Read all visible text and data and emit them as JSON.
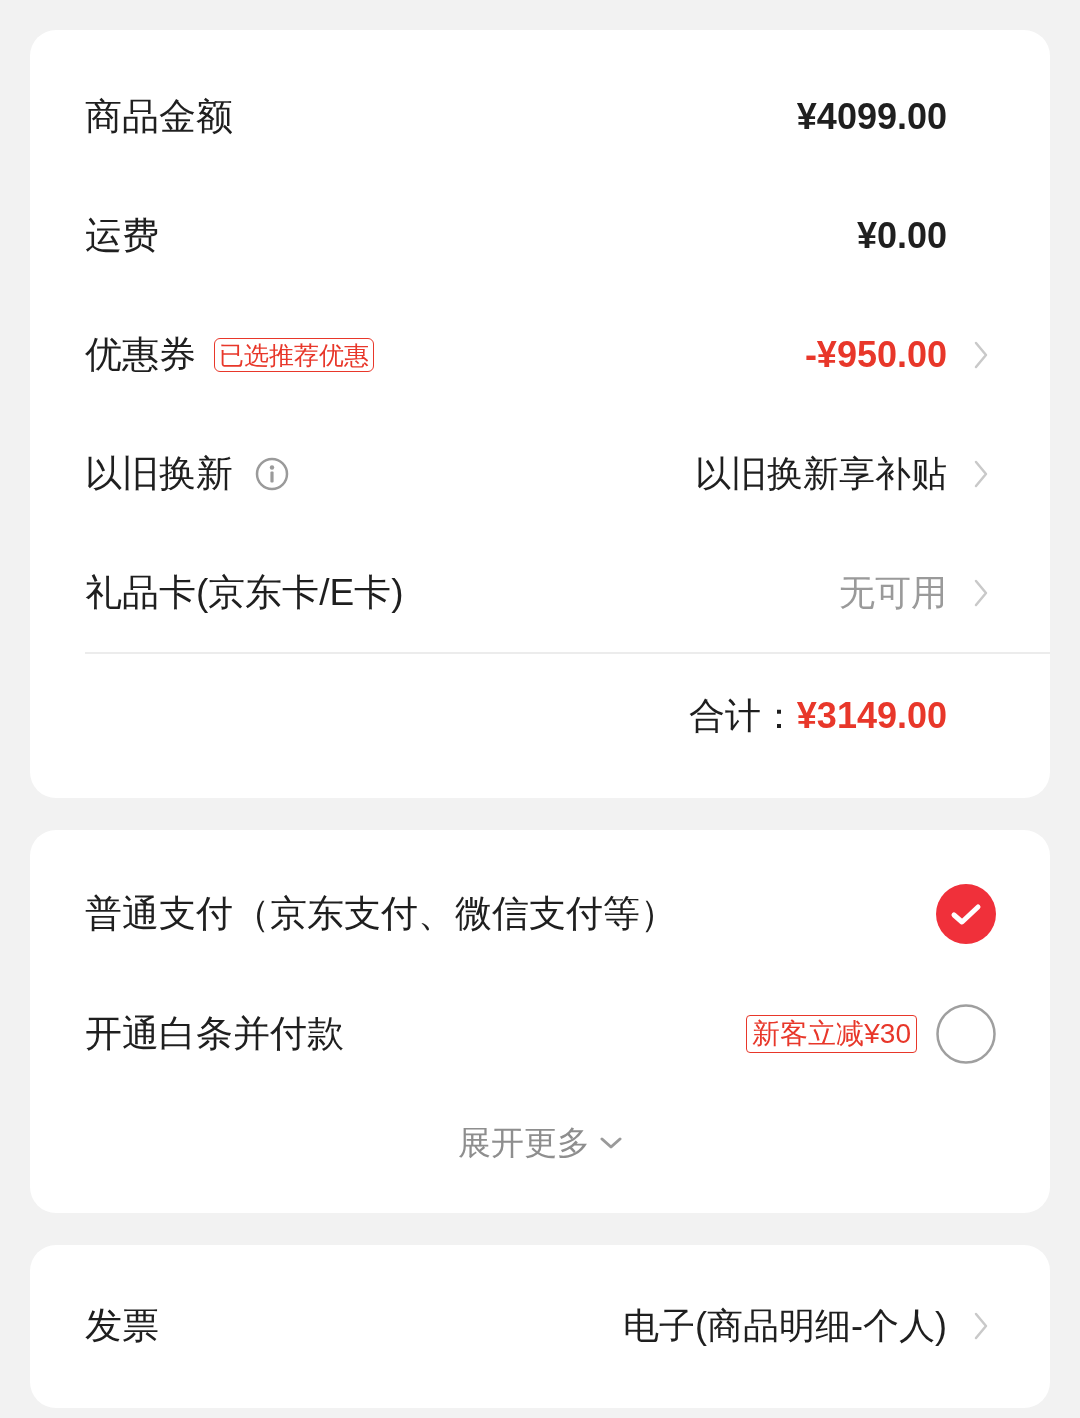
{
  "summary": {
    "rows": [
      {
        "label": "商品金额",
        "kind": "amount",
        "value": "¥4099.00"
      },
      {
        "label": "运费",
        "kind": "amount",
        "value": "¥0.00"
      },
      {
        "label": "优惠券",
        "tag": "已选推荐优惠",
        "kind": "discount",
        "value": "-¥950.00",
        "chevron": true
      },
      {
        "label": "以旧换新",
        "kind": "text",
        "value": "以旧换新享补贴",
        "info": true,
        "chevron": true
      },
      {
        "label": "礼品卡(京东卡/E卡)",
        "kind": "muted",
        "value": "无可用",
        "chevron": true
      }
    ],
    "total": {
      "label": "合计：",
      "value": "¥3149.00"
    }
  },
  "payment": {
    "options": [
      {
        "label": "普通支付（京东支付、微信支付等）",
        "selected": true
      },
      {
        "label": "开通白条并付款",
        "badge": "新客立减¥30",
        "selected": false
      }
    ],
    "expand": "展开更多"
  },
  "invoice": {
    "label": "发票",
    "value": "电子(商品明细-个人)",
    "chevron": true
  }
}
